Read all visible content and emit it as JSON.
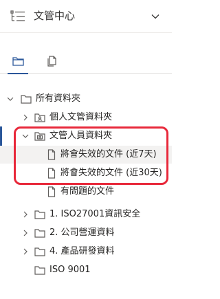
{
  "app": {
    "title": "文管中心"
  },
  "tabs": [
    {
      "name": "folders",
      "icon": "folder-icon",
      "active": true
    },
    {
      "name": "documents",
      "icon": "documents-icon",
      "active": false
    }
  ],
  "tree": {
    "root": {
      "label": "所有資料夾",
      "expanded": true
    },
    "items": [
      {
        "label": "個人文管資料夾",
        "icon": "personal-folder-icon",
        "expanded": false
      },
      {
        "label": "文管人員資料夾",
        "icon": "camera-folder-icon",
        "expanded": true,
        "children": [
          {
            "label": "將會失效的文件 (近7天)",
            "icon": "document-icon"
          },
          {
            "label": "將會失效的文件 (近30天)",
            "icon": "document-icon"
          },
          {
            "label": "有問題的文件",
            "icon": "document-icon"
          }
        ]
      },
      {
        "label": "1. ISO27001資訊安全",
        "icon": "folder-icon",
        "expanded": false
      },
      {
        "label": "2. 公司營運資料",
        "icon": "folder-icon",
        "expanded": false
      },
      {
        "label": "4. 產品研發資料",
        "icon": "folder-icon",
        "expanded": false
      },
      {
        "label": "ISO 9001",
        "icon": "folder-icon",
        "expanded": null
      }
    ]
  },
  "colors": {
    "accent": "#2b579a",
    "highlight": "#e8283a",
    "text": "#252423"
  }
}
